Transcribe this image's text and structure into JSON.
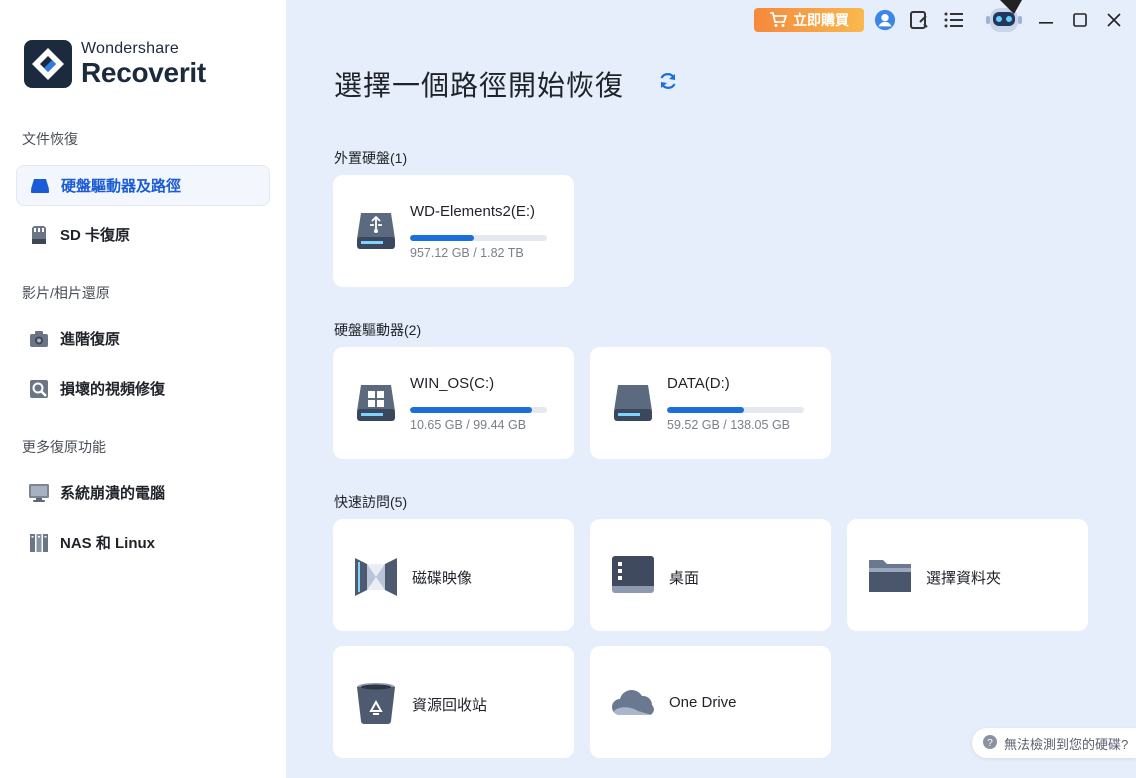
{
  "brand": {
    "top": "Wondershare",
    "main": "Recoverit"
  },
  "sidebar": {
    "sections": [
      {
        "title": "文件恢復",
        "items": [
          {
            "label": "硬盤驅動器及路徑",
            "active": true
          },
          {
            "label": "SD 卡復原"
          }
        ]
      },
      {
        "title": "影片/相片還原",
        "items": [
          {
            "label": "進階復原"
          },
          {
            "label": "損壞的視頻修復"
          }
        ]
      },
      {
        "title": "更多復原功能",
        "items": [
          {
            "label": "系統崩潰的電腦"
          },
          {
            "label": "NAS 和 Linux"
          }
        ]
      }
    ]
  },
  "topbar": {
    "buy_label": "立即購買"
  },
  "main": {
    "title": "選擇一個路徑開始恢復",
    "groups": {
      "external": {
        "title": "外置硬盤(1)",
        "drives": [
          {
            "name": "WD-Elements2(E:)",
            "size": "957.12 GB / 1.82 TB",
            "usage": 0.52,
            "icon": "usb-drive-icon"
          }
        ]
      },
      "hdd": {
        "title": "硬盤驅動器(2)",
        "drives": [
          {
            "name": "WIN_OS(C:)",
            "size": "10.65 GB / 99.44 GB",
            "usage": 0.89,
            "icon": "windows-drive-icon"
          },
          {
            "name": "DATA(D:)",
            "size": "59.52 GB / 138.05 GB",
            "usage": 0.56,
            "icon": "hard-drive-icon"
          }
        ]
      },
      "quick": {
        "title": "快速訪問(5)",
        "items": [
          {
            "label": "磁碟映像",
            "icon": "disk-image-icon"
          },
          {
            "label": "桌面",
            "icon": "desktop-icon"
          },
          {
            "label": "選擇資料夾",
            "icon": "folder-icon"
          },
          {
            "label": "資源回收站",
            "icon": "recycle-bin-icon"
          },
          {
            "label": "One Drive",
            "icon": "onedrive-icon"
          }
        ]
      }
    }
  },
  "toast": {
    "text": "無法檢測到您的硬碟?"
  },
  "colors": {
    "accent": "#1a6fd8",
    "buy_start": "#f6883c",
    "buy_end": "#f9b94e",
    "sidebar_bg": "#ffffff",
    "main_bg": "#e6eefb"
  }
}
